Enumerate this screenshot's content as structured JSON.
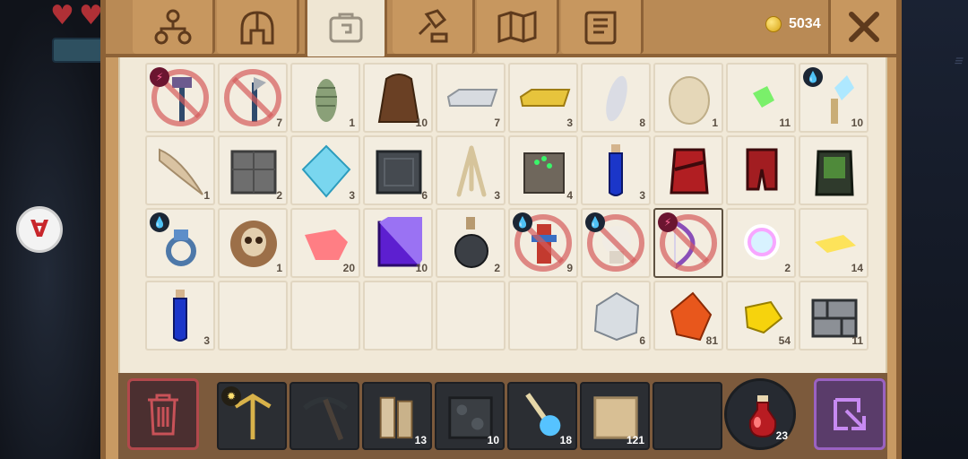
{
  "hud": {
    "hearts": [
      "heart",
      "heart"
    ]
  },
  "header": {
    "tabs": [
      {
        "id": "skills",
        "icon": "skill-tree-icon"
      },
      {
        "id": "armor",
        "icon": "helmet-icon"
      },
      {
        "id": "inventory",
        "icon": "backpack-icon",
        "active": true
      },
      {
        "id": "crafting",
        "icon": "hammer-icon"
      },
      {
        "id": "map",
        "icon": "map-icon"
      },
      {
        "id": "quests",
        "icon": "scroll-icon"
      }
    ],
    "coins": "5034",
    "close_icon": "close-icon"
  },
  "inventory": {
    "slots": [
      {
        "item": "enchanted-hammer-weapon",
        "count": "",
        "badge": "power",
        "disabled": true
      },
      {
        "item": "axe-weapon",
        "count": "7",
        "disabled": true
      },
      {
        "item": "pine-cone",
        "count": "1"
      },
      {
        "item": "leather-cloak",
        "count": "10"
      },
      {
        "item": "iron-ingot",
        "count": "7"
      },
      {
        "item": "gold-ingot",
        "count": "3"
      },
      {
        "item": "cotton-wrap",
        "count": "8"
      },
      {
        "item": "egg",
        "count": "1"
      },
      {
        "item": "green-crystal-shard",
        "count": "11"
      },
      {
        "item": "ice-crystal-staff",
        "count": "10",
        "badge": "water"
      },
      {
        "item": "horn-tusk",
        "count": "1"
      },
      {
        "item": "stone-block",
        "count": "2"
      },
      {
        "item": "diamond-crystal",
        "count": "3"
      },
      {
        "item": "dark-metal-block",
        "count": "6"
      },
      {
        "item": "bone-sticks",
        "count": "3"
      },
      {
        "item": "ore-block",
        "count": "4"
      },
      {
        "item": "blue-potion-vial",
        "count": "3"
      },
      {
        "item": "red-chest-armor",
        "count": ""
      },
      {
        "item": "red-leg-armor",
        "count": ""
      },
      {
        "item": "green-dark-armor",
        "count": ""
      },
      {
        "item": "blue-ring",
        "count": "",
        "badge": "water"
      },
      {
        "item": "bronze-skull-medallion",
        "count": "1"
      },
      {
        "item": "pink-crystal-chunk",
        "count": "20"
      },
      {
        "item": "purple-crystal-block",
        "count": "10"
      },
      {
        "item": "black-flask",
        "count": "2"
      },
      {
        "item": "totem-doll",
        "count": "9",
        "badge": "water",
        "disabled": true
      },
      {
        "item": "white-skull-charm",
        "count": "",
        "badge": "water",
        "disabled": true
      },
      {
        "item": "bow-weapon",
        "count": "",
        "badge": "power",
        "disabled": true,
        "selected": true
      },
      {
        "item": "rainbow-orb",
        "count": "2"
      },
      {
        "item": "yellow-crystal-shard",
        "count": "14"
      },
      {
        "item": "blue-potion-vial",
        "count": "3"
      },
      {
        "item": "",
        "count": ""
      },
      {
        "item": "",
        "count": ""
      },
      {
        "item": "",
        "count": ""
      },
      {
        "item": "",
        "count": ""
      },
      {
        "item": "",
        "count": ""
      },
      {
        "item": "silver-ore",
        "count": "6"
      },
      {
        "item": "amber-gem",
        "count": "81"
      },
      {
        "item": "gold-nugget",
        "count": "54"
      },
      {
        "item": "stone-bricks",
        "count": "11"
      }
    ]
  },
  "hotbar": {
    "trash_icon": "trash-icon",
    "slots": [
      {
        "item": "crossbow-weapon",
        "count": "",
        "badge": "sun"
      },
      {
        "item": "pickaxe-tool",
        "count": ""
      },
      {
        "item": "wood-logs",
        "count": "13"
      },
      {
        "item": "cobblestone-block",
        "count": "10"
      },
      {
        "item": "magic-wand",
        "count": "18"
      },
      {
        "item": "sand-block",
        "count": "121"
      },
      {
        "item": "",
        "count": ""
      }
    ],
    "potion": {
      "item": "red-health-potion",
      "count": "23"
    },
    "swap_icon": "swap-icon"
  }
}
